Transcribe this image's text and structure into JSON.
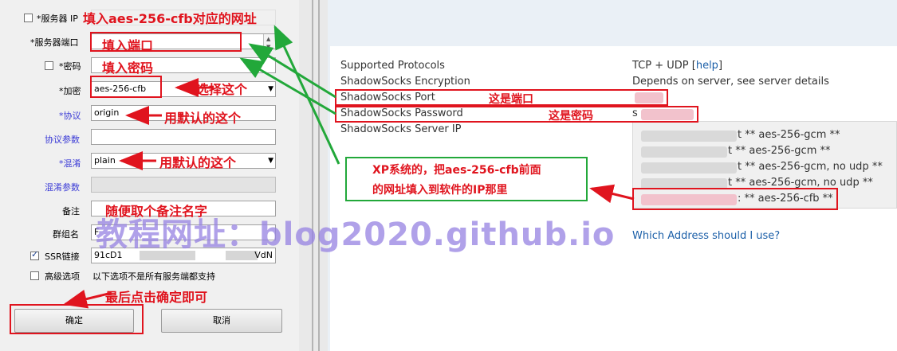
{
  "dialog": {
    "server_ip_label": "*服务器 IP",
    "server_port_label": "*服务器端口",
    "password_label": "*密码",
    "encryption_label": "*加密",
    "encryption_value": "aes-256-cfb",
    "protocol_label": "*协议",
    "protocol_value": "origin",
    "protocol_param_label": "协议参数",
    "obfs_label": "*混淆",
    "obfs_value": "plain",
    "obfs_param_label": "混淆参数",
    "remark_label": "备注",
    "group_label": "群组名",
    "group_value": "F",
    "ssr_link_label": "SSR链接",
    "ssr_link_value_start": "91cD1",
    "ssr_link_value_end": "VdN",
    "advanced_label": "高级选项",
    "advanced_note": "以下选项不是所有服务端都支持",
    "ok_button": "确定",
    "cancel_button": "取消"
  },
  "details": {
    "rows": [
      {
        "label": "Supported Protocols",
        "value": "TCP + UDP [",
        "link": "help",
        "tail": "]"
      },
      {
        "label": "ShadowSocks Encryption",
        "value": "Depends on server, see server details"
      },
      {
        "label": "ShadowSocks Port",
        "value": ""
      },
      {
        "label": "ShadowSocks Password",
        "value": "s"
      },
      {
        "label": "ShadowSocks Server IP",
        "value": ""
      }
    ],
    "servers": [
      "t ** aes-256-gcm **",
      "t ** aes-256-gcm **",
      "t ** aes-256-gcm, no udp **",
      "t ** aes-256-gcm, no udp **",
      ": ** aes-256-cfb **"
    ],
    "which_address_link": "Which Address should I use?"
  },
  "annotations": {
    "fill_address": "填入aes-256-cfb对应的网址",
    "fill_port": "填入端口",
    "fill_password": "填入密码",
    "choose_this": "选择这个",
    "use_default_1": "用默认的这个",
    "use_default_2": "用默认的这个",
    "any_remark": "随便取个备注名字",
    "click_ok": "最后点击确定即可",
    "this_is_port": "这是端口",
    "this_is_password": "这是密码",
    "xp_note_line1": "XP系统的，把aes-256-cfb前面",
    "xp_note_line2": "的网址填入到软件的IP那里",
    "watermark": "教程网址：blog2020.github.io"
  },
  "colors": {
    "annotation_red": "#e0141e",
    "annotation_green": "#22a83a",
    "link_blue": "#1b5fa8",
    "watermark_purple": "#9682e1"
  }
}
